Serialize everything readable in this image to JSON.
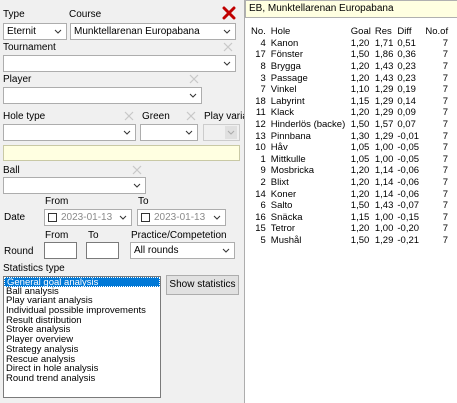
{
  "filters": {
    "type_label": "Type",
    "type_value": "Eternit",
    "course_label": "Course",
    "course_value": "Munktellarenan Europabana",
    "tournament_label": "Tournament",
    "tournament_value": "",
    "player_label": "Player",
    "player_value": "",
    "hole_type_label": "Hole type",
    "green_label": "Green",
    "play_variant_label": "Play varia",
    "ball_label": "Ball",
    "date_label": "Date",
    "from_label": "From",
    "to_label": "To",
    "date_from": "2023-01-13",
    "date_to": "2023-01-13",
    "round_label": "Round",
    "round_from_label": "From",
    "round_to_label": "To",
    "practice_label": "Practice/Competetion",
    "practice_value": "All rounds",
    "stats_type_label": "Statistics type",
    "show_stats_button": "Show statistics"
  },
  "stats_types": [
    "General goal analysis",
    "Ball analysis",
    "Play variant analysis",
    "Individual possible improvements",
    "Result distribution",
    "Stroke analysis",
    "Player overview",
    "Strategy analysis",
    "Rescue analysis",
    "Direct in hole analysis",
    "Round trend analysis"
  ],
  "results": {
    "title": "EB, Munktellarenan Europabana",
    "headers": [
      "No.",
      "Hole",
      "Goal",
      "Res",
      "Diff",
      "No.of"
    ],
    "rows": [
      [
        "4",
        "Kanon",
        "1,20",
        "1,71",
        "0,51",
        "7"
      ],
      [
        "17",
        "Fönster",
        "1,50",
        "1,86",
        "0,36",
        "7"
      ],
      [
        "8",
        "Brygga",
        "1,20",
        "1,43",
        "0,23",
        "7"
      ],
      [
        "3",
        "Passage",
        "1,20",
        "1,43",
        "0,23",
        "7"
      ],
      [
        "7",
        "Vinkel",
        "1,10",
        "1,29",
        "0,19",
        "7"
      ],
      [
        "18",
        "Labyrint",
        "1,15",
        "1,29",
        "0,14",
        "7"
      ],
      [
        "11",
        "Klack",
        "1,20",
        "1,29",
        "0,09",
        "7"
      ],
      [
        "12",
        "Hinderlös (backe)",
        "1,50",
        "1,57",
        "0,07",
        "7"
      ],
      [
        "13",
        "Pinnbana",
        "1,30",
        "1,29",
        "-0,01",
        "7"
      ],
      [
        "10",
        "Håv",
        "1,05",
        "1,00",
        "-0,05",
        "7"
      ],
      [
        "1",
        "Mittkulle",
        "1,05",
        "1,00",
        "-0,05",
        "7"
      ],
      [
        "9",
        "Mosbricka",
        "1,20",
        "1,14",
        "-0,06",
        "7"
      ],
      [
        "2",
        "Blixt",
        "1,20",
        "1,14",
        "-0,06",
        "7"
      ],
      [
        "14",
        "Koner",
        "1,20",
        "1,14",
        "-0,06",
        "7"
      ],
      [
        "6",
        "Salto",
        "1,50",
        "1,43",
        "-0,07",
        "7"
      ],
      [
        "16",
        "Snäcka",
        "1,15",
        "1,00",
        "-0,15",
        "7"
      ],
      [
        "15",
        "Tetror",
        "1,20",
        "1,00",
        "-0,20",
        "7"
      ],
      [
        "5",
        "Mushål",
        "1,50",
        "1,29",
        "-0,21",
        "7"
      ]
    ]
  },
  "colors": {
    "selection": "#0078d7",
    "close_red": "#c00000",
    "info_yellow": "#ffffe1"
  }
}
